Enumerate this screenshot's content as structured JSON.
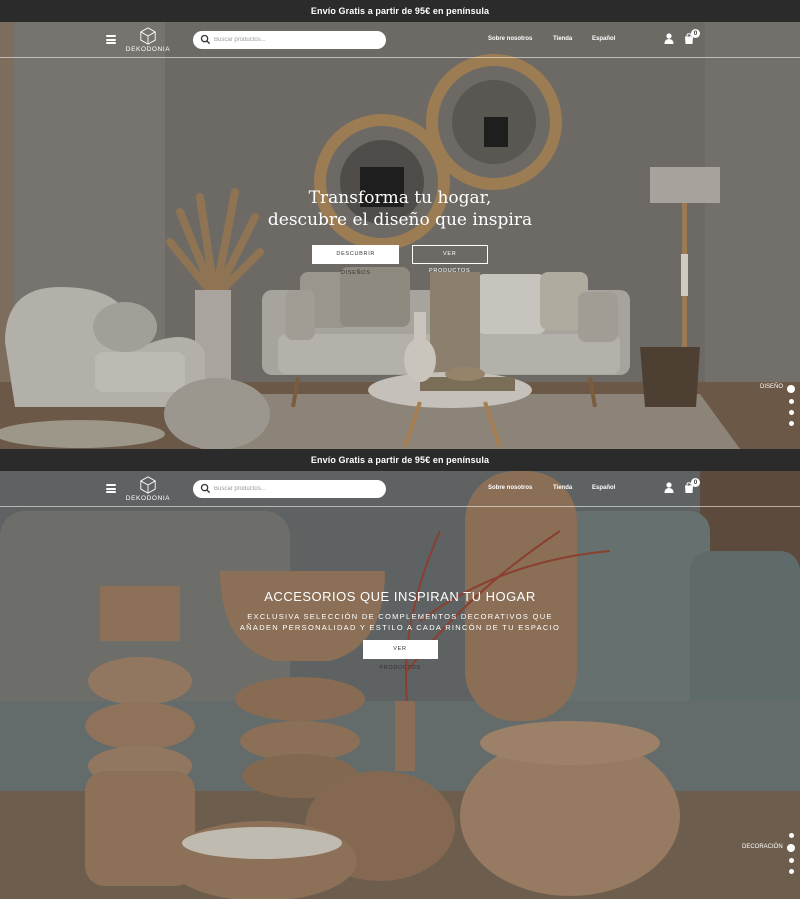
{
  "announcement": "Envío Gratis a partir de 95€ en península",
  "header": {
    "logo_text": "DEKODONIA",
    "search_placeholder": "Buscar productos...",
    "nav": [
      "Sobre nosotros",
      "Tienda",
      "Español"
    ],
    "cart_count": "0"
  },
  "slide1": {
    "heading_line1": "Transforma tu hogar,",
    "heading_line2": "descubre el diseño que inspira",
    "button_primary": "DESCUBRIR DISEÑOS",
    "button_secondary": "VER PRODUCTOS",
    "slide_label": "DISEÑO"
  },
  "slide2": {
    "heading": "ACCESORIOS QUE INSPIRAN TU HOGAR",
    "subtitle_line1": "EXCLUSIVA SELECCIÓN DE COMPLEMENTOS DECORATIVOS QUE",
    "subtitle_line2": "AÑADEN PERSONALIDAD Y ESTILO A CADA RINCÓN DE TU ESPACIO",
    "button": "VER PRODUCTOS",
    "slide_label": "DECORACIÓN"
  },
  "icons": [
    "menu-icon",
    "logo-cube-icon",
    "search-icon",
    "user-icon",
    "cart-icon"
  ],
  "colors": {
    "announcement_bg": "#2b2b2b",
    "text": "#ffffff",
    "button_bg": "#ffffff"
  }
}
